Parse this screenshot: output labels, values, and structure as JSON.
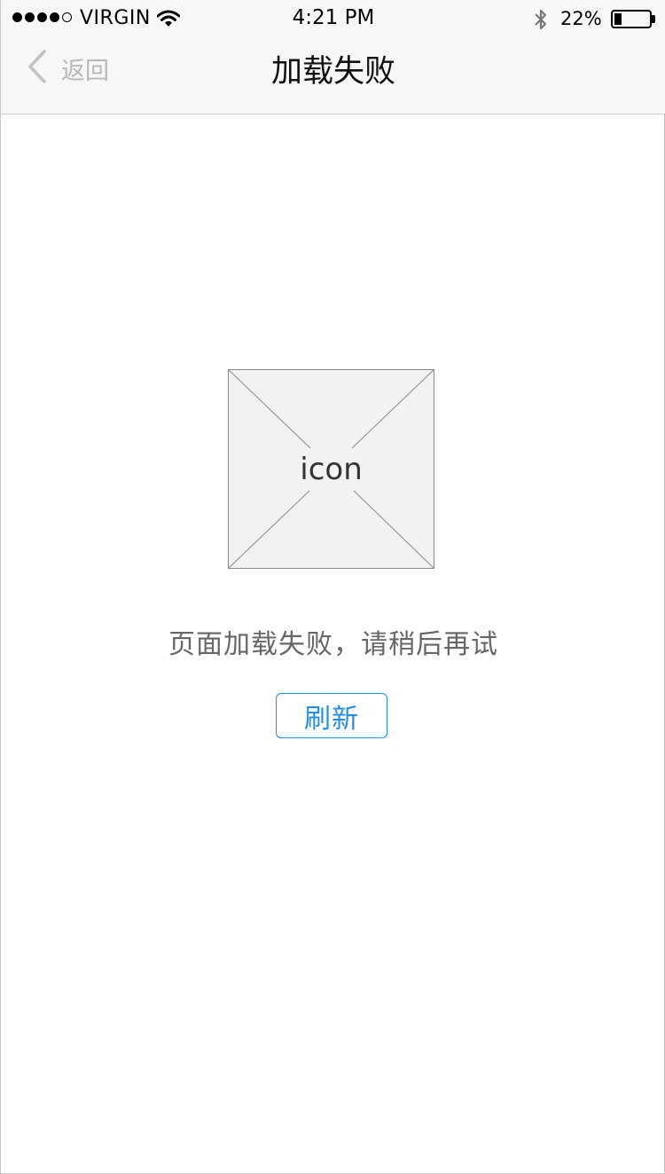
{
  "status_bar": {
    "carrier": "VIRGIN",
    "time": "4:21 PM",
    "battery_percent": "22%",
    "battery_level": 0.22,
    "signal_bars_filled": 4,
    "signal_bars_total": 5
  },
  "nav": {
    "back_label": "返回",
    "title": "加载失败"
  },
  "content": {
    "icon_placeholder_label": "icon",
    "error_message": "页面加载失败，请稍后再试",
    "refresh_label": "刷新"
  },
  "colors": {
    "accent": "#1e90e8",
    "nav_background": "#f7f7f7",
    "placeholder_fill": "#f2f2f2"
  }
}
